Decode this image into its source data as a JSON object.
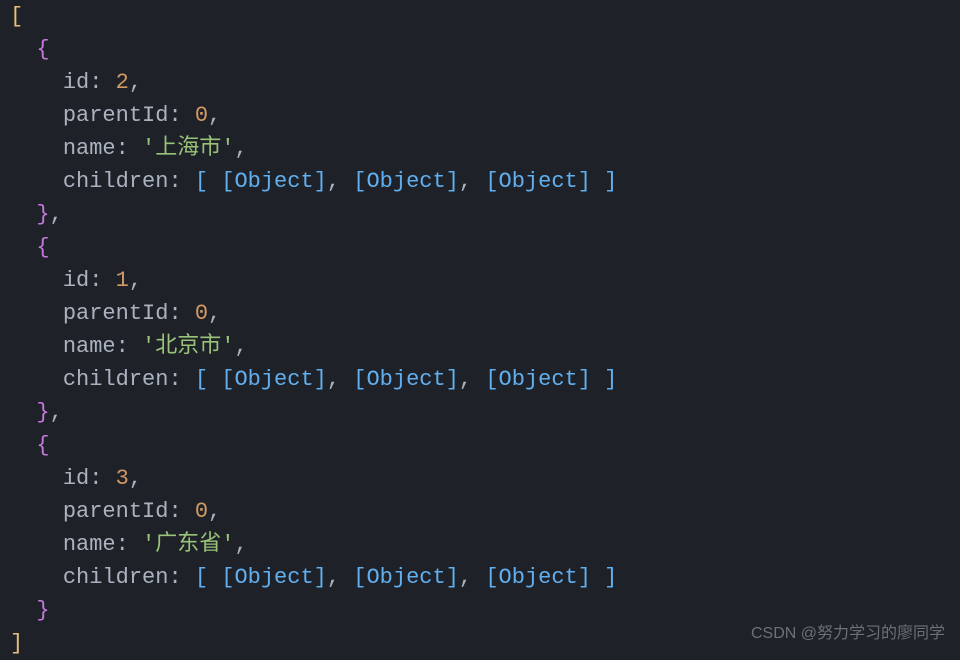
{
  "code": {
    "items": [
      {
        "id_key": "id",
        "id_val": "2",
        "parent_key": "parentId",
        "parent_val": "0",
        "name_key": "name",
        "name_val": "'上海市'",
        "children_key": "children",
        "object_ref": "[Object]"
      },
      {
        "id_key": "id",
        "id_val": "1",
        "parent_key": "parentId",
        "parent_val": "0",
        "name_key": "name",
        "name_val": "'北京市'",
        "children_key": "children",
        "object_ref": "[Object]"
      },
      {
        "id_key": "id",
        "id_val": "3",
        "parent_key": "parentId",
        "parent_val": "0",
        "name_key": "name",
        "name_val": "'广东省'",
        "children_key": "children",
        "object_ref": "[Object]"
      }
    ]
  },
  "brackets": {
    "open_square": "[",
    "close_square": "]",
    "open_curly": "{",
    "close_curly": "}",
    "colon": ":",
    "comma": ","
  },
  "watermark": "CSDN @努力学习的廖同学"
}
